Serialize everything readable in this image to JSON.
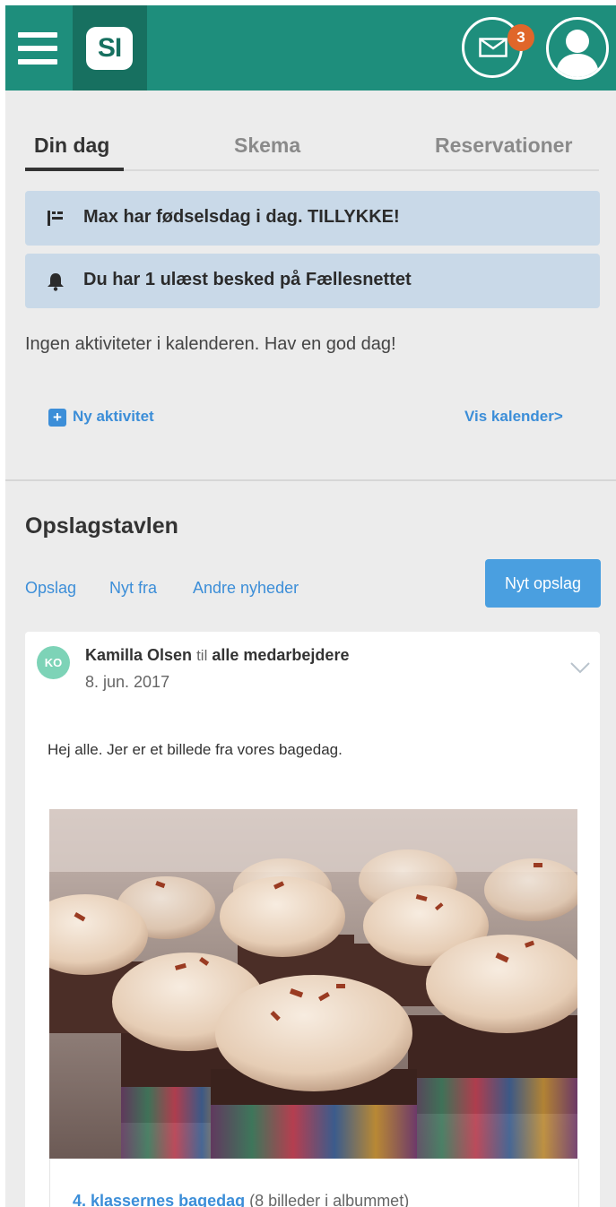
{
  "header": {
    "logo_text": "SI",
    "mail_badge": "3",
    "brand_color": "#1e8e7c",
    "logo_bg": "#177060"
  },
  "tabs": [
    "Din dag",
    "Skema",
    "Reservationer"
  ],
  "notices": [
    {
      "icon": "flag-icon",
      "text": "Max har fødselsdag i dag. TILLYKKE!"
    },
    {
      "icon": "bell-icon",
      "text": "Du har 1 ulæst besked på Fællesnettet"
    }
  ],
  "calendar": {
    "empty_message": "Ingen aktiviteter i kalenderen. Hav en god dag!",
    "new_activity": "Ny aktivitet",
    "show_calendar": "Vis kalender>"
  },
  "board": {
    "title": "Opslagstavlen",
    "filters": [
      "Opslag",
      "Nyt fra",
      "Andre nyheder"
    ],
    "new_post": "Nyt opslag"
  },
  "post": {
    "initials": "KO",
    "author": "Kamilla Olsen",
    "to_word": "til",
    "audience": "alle medarbejdere",
    "date": "8. jun. 2017",
    "body": "Hej alle. Jer er et billede fra vores bagedag.",
    "album_title": "4. klassernes bagedag",
    "album_meta": "(8 billeder i albummet)"
  },
  "colors": {
    "link": "#3c8ed8",
    "notice_bg": "#c9d9e8",
    "badge": "#e0662a",
    "initials_bg": "#7dd3b7"
  }
}
